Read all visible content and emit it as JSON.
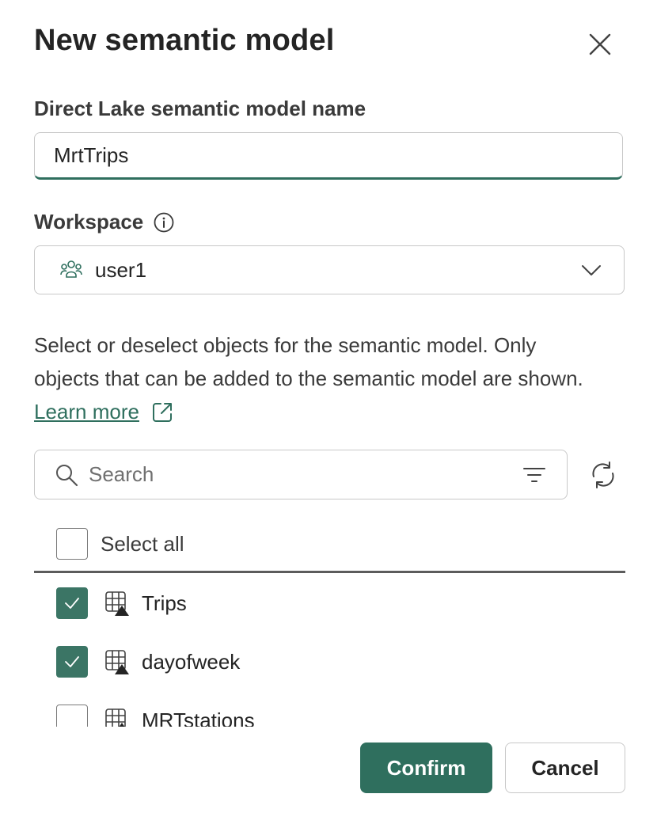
{
  "dialog": {
    "title": "New semantic model",
    "close_icon": "close-icon"
  },
  "model_name": {
    "label": "Direct Lake semantic model name",
    "value": "MrtTrips"
  },
  "workspace": {
    "label": "Workspace",
    "info_icon": "info-icon",
    "icon": "workspace-people-icon",
    "value": "user1",
    "dropdown_icon": "chevron-down-icon"
  },
  "description": {
    "text": "Select or deselect objects for the semantic model. Only objects that can be added to the semantic model are shown.",
    "link_text": "Learn more",
    "link_icon": "external-link-icon"
  },
  "search": {
    "placeholder": "Search",
    "value": "",
    "icon": "search-icon",
    "filter_icon": "filter-icon",
    "refresh_icon": "refresh-icon"
  },
  "select_all": {
    "label": "Select all",
    "checked": false
  },
  "objects": [
    {
      "name": "Trips",
      "checked": true,
      "icon": "table-icon"
    },
    {
      "name": "dayofweek",
      "checked": true,
      "icon": "table-icon"
    },
    {
      "name": "MRTstations",
      "checked": false,
      "icon": "table-icon"
    }
  ],
  "buttons": {
    "confirm": "Confirm",
    "cancel": "Cancel"
  },
  "colors": {
    "accent": "#2f6f5e",
    "checkbox_checked": "#3b7565",
    "border": "#c8c8c8"
  }
}
